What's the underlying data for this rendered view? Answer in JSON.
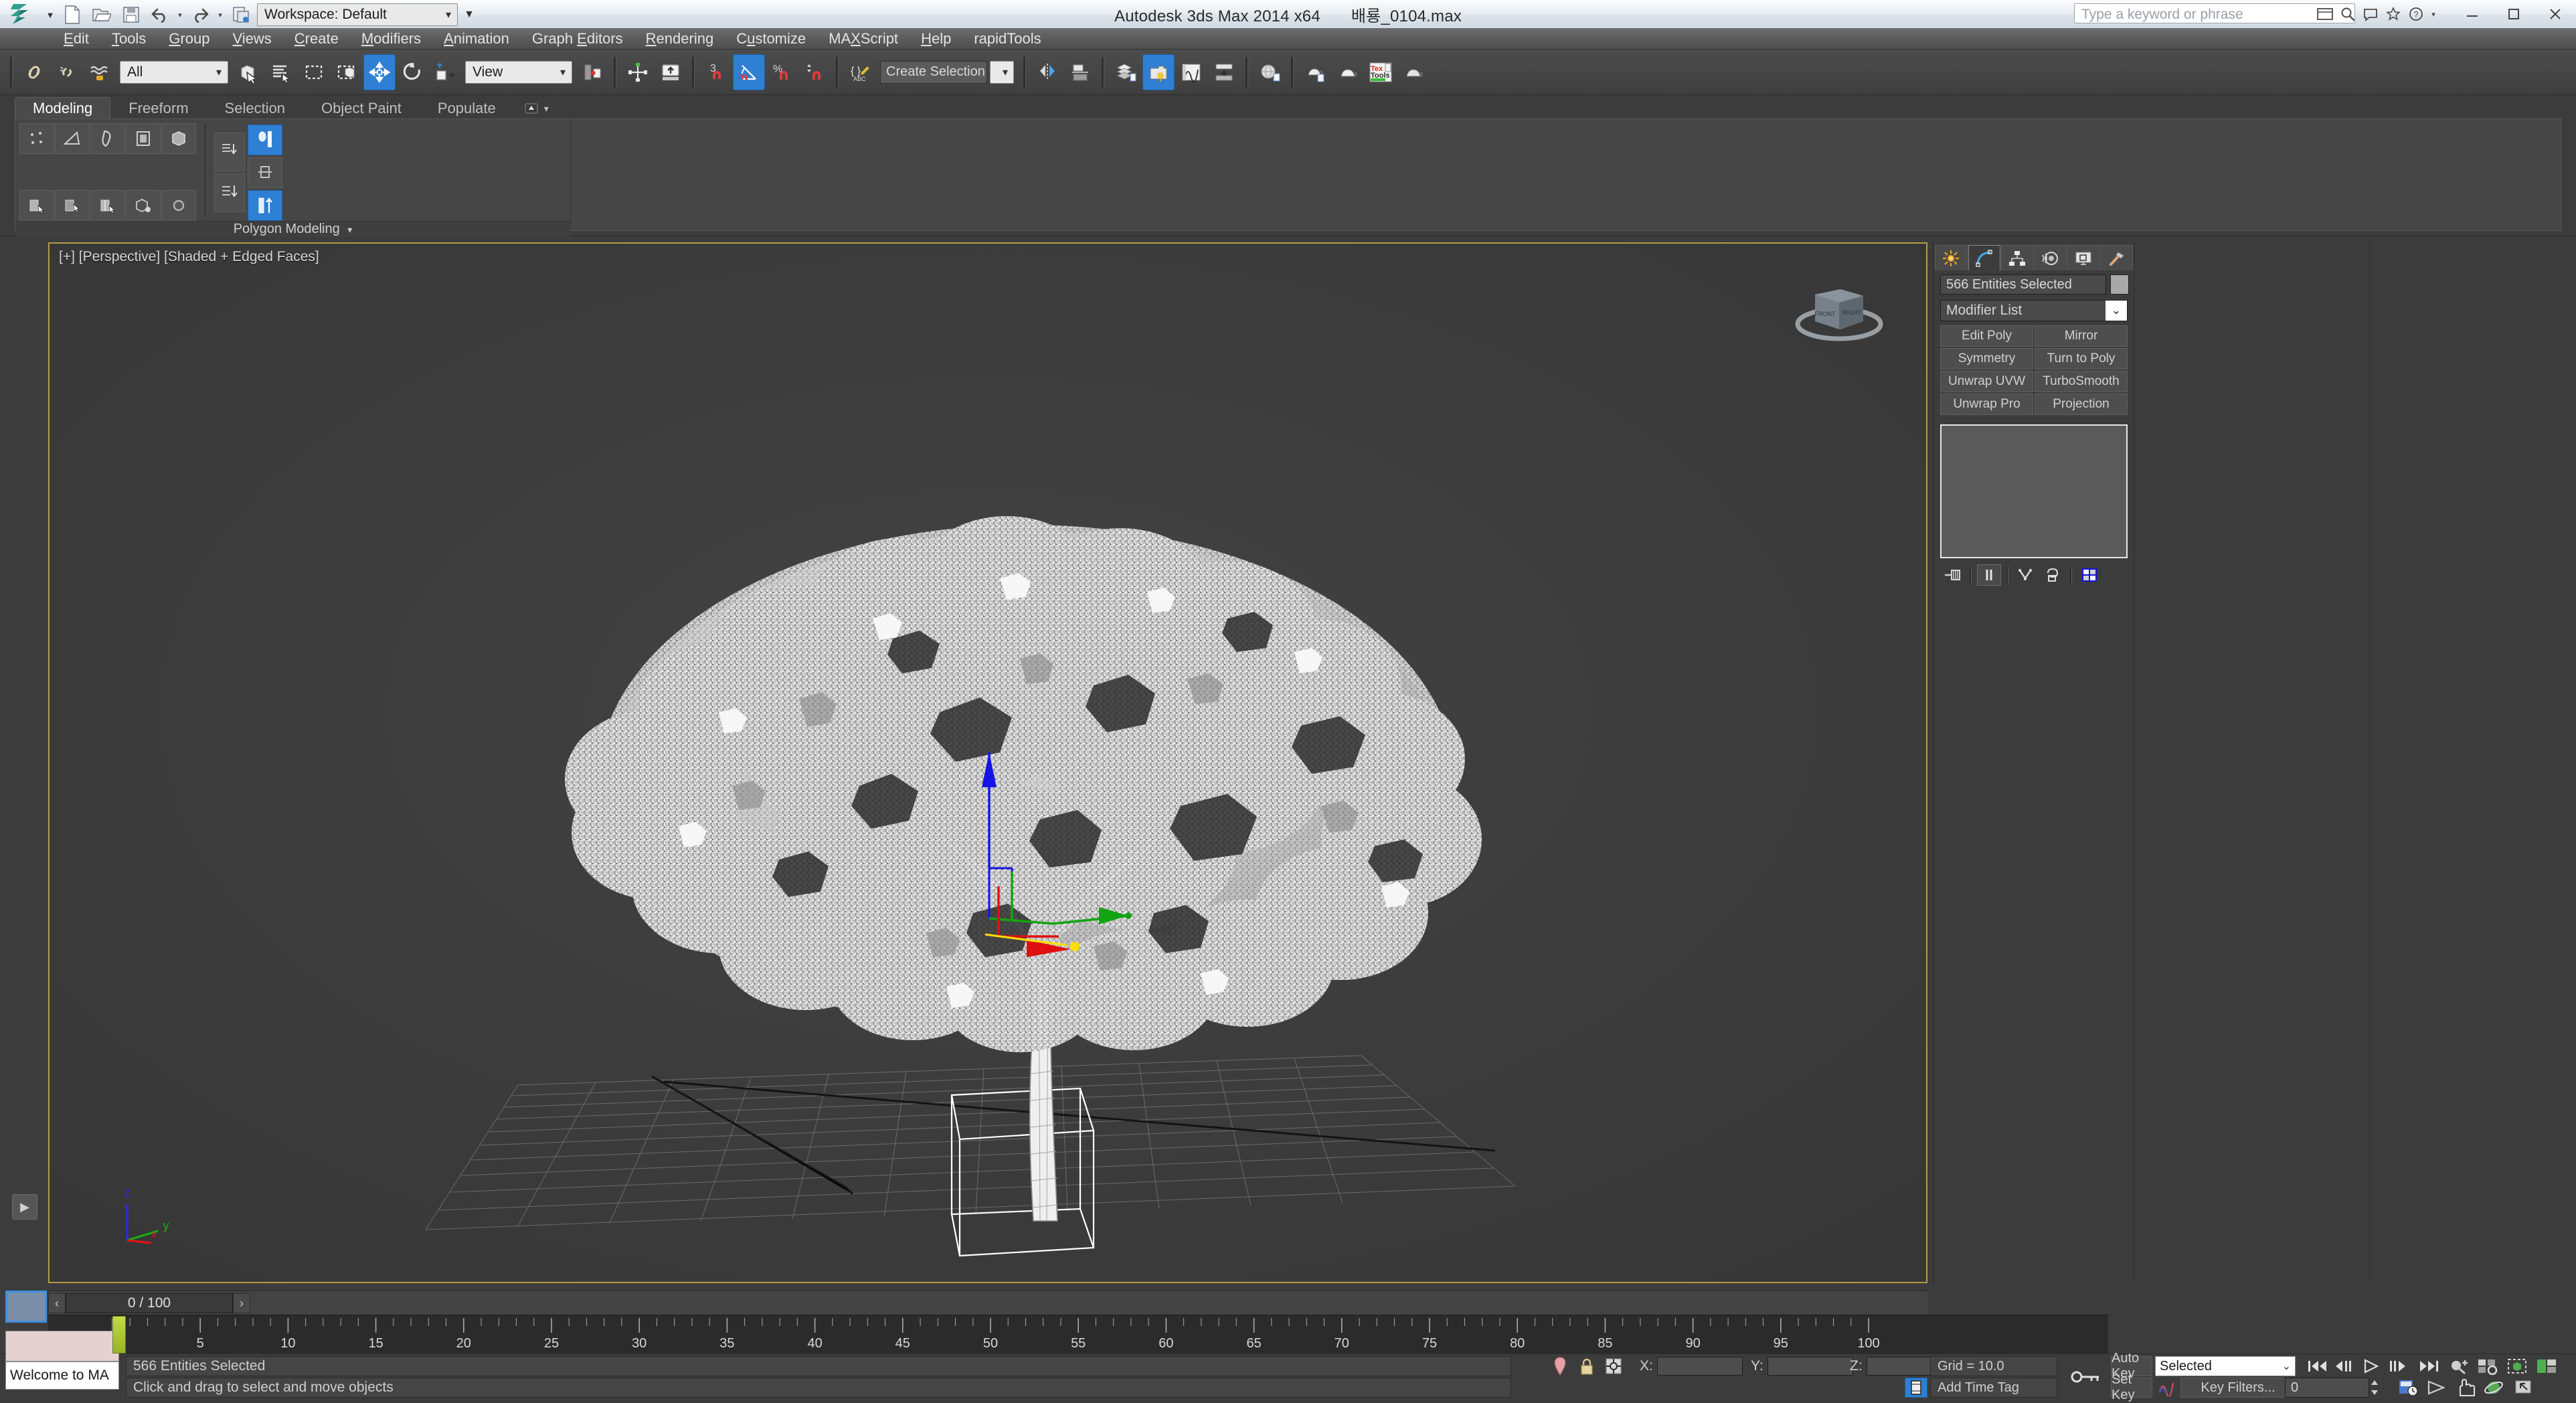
{
  "window": {
    "app_title": "Autodesk 3ds Max  2014 x64",
    "file_name": "배룡_0104.max",
    "search_placeholder": "Type a keyword or phrase",
    "minimize": "—",
    "maximize": "▢",
    "close": "✕"
  },
  "quick_access": {
    "workspace_label": "Workspace: Default",
    "items": [
      "new-file-icon",
      "open-file-icon",
      "save-file-icon",
      "undo-icon",
      "redo-icon",
      "workspace-icon"
    ]
  },
  "menu": {
    "items": [
      {
        "label": "Edit",
        "accel": "E"
      },
      {
        "label": "Tools",
        "accel": "T"
      },
      {
        "label": "Group",
        "accel": "G"
      },
      {
        "label": "Views",
        "accel": "V"
      },
      {
        "label": "Create",
        "accel": "C"
      },
      {
        "label": "Modifiers",
        "accel": "M"
      },
      {
        "label": "Animation",
        "accel": "A"
      },
      {
        "label": "Graph Editors",
        "accel": "E"
      },
      {
        "label": "Rendering",
        "accel": "R"
      },
      {
        "label": "Customize",
        "accel": "u"
      },
      {
        "label": "MAXScript",
        "accel": "X"
      },
      {
        "label": "Help",
        "accel": "H"
      },
      {
        "label": "rapidTools",
        "accel": ""
      }
    ]
  },
  "toolbar": {
    "select_filter": "All",
    "coord_system": "View",
    "selection_set": "Create Selection Set",
    "buttons": [
      "select-and-link-icon",
      "unlink-selection-icon",
      "bind-to-space-warp-icon",
      "select-object-icon",
      "select-by-name-icon",
      "rectangular-selection-region-icon",
      "window-crossing-icon",
      "select-and-move-icon",
      "select-and-rotate-icon",
      "select-and-scale-icon",
      "use-pivot-point-center-icon",
      "select-and-manipulate-icon",
      "snaps-toggle-icon",
      "angle-snap-toggle-icon",
      "percent-snap-toggle-icon",
      "spinner-snap-toggle-icon",
      "named-selection-sets-icon",
      "mirror-icon",
      "align-icon",
      "layer-manager-icon",
      "compact-material-editor-icon",
      "curve-editor-icon",
      "schematic-view-icon",
      "render-setup-icon",
      "rendered-frame-window-icon",
      "render-production-icon",
      "tex-tools-icon",
      "render-iterative-icon"
    ],
    "active_tool": "select-and-move-icon",
    "tex_tools_label_1": "Tex",
    "tex_tools_label_2": "Tools"
  },
  "ribbon": {
    "tabs": [
      {
        "label": "Modeling",
        "active": true
      },
      {
        "label": "Freeform",
        "active": false
      },
      {
        "label": "Selection",
        "active": false
      },
      {
        "label": "Object Paint",
        "active": false
      },
      {
        "label": "Populate",
        "active": false
      }
    ],
    "panel_label": "Polygon Modeling",
    "subobject_buttons": [
      "vertex-subobject-icon",
      "edge-subobject-icon",
      "border-subobject-icon",
      "polygon-subobject-icon",
      "element-subobject-icon"
    ],
    "tool_buttons": [
      "generate-topology-icon",
      "repeat-last-icon",
      "swift-loop-icon",
      "paint-connect-icon",
      "nurms-toggle-icon"
    ],
    "stack_buttons": [
      "collapse-stack-icon",
      "make-editable-poly-icon"
    ],
    "right_buttons": [
      "full-interactivity-icon",
      "constraint-icon",
      "preserve-uvs-icon"
    ]
  },
  "viewport": {
    "label": "[+] [Perspective] [Shaded + Edged Faces]",
    "view_type": "Perspective",
    "shading": "Shaded + Edged Faces",
    "axis_x": "x",
    "axis_y": "y",
    "axis_z": "z",
    "viewcube_front": "FRONT",
    "viewcube_right": "RIGHT",
    "border_color": "#b39b47",
    "background_color": "#3d3d3d",
    "gizmo_colors": {
      "x": "#e02020",
      "y": "#18b018",
      "z": "#2020e0",
      "highlight": "#ffe000"
    }
  },
  "command_panel": {
    "tabs": [
      {
        "name": "create-tab",
        "active": false
      },
      {
        "name": "modify-tab",
        "active": true
      },
      {
        "name": "hierarchy-tab",
        "active": false
      },
      {
        "name": "motion-tab",
        "active": false
      },
      {
        "name": "display-tab",
        "active": false
      },
      {
        "name": "utilities-tab",
        "active": false
      }
    ],
    "object_name": "566 Entities Selected",
    "modifier_list_label": "Modifier List",
    "modifier_buttons": [
      "Edit Poly",
      "Mirror",
      "Symmetry",
      "Turn to Poly",
      "Unwrap UVW",
      "TurboSmooth",
      "Unwrap Pro",
      "Projection"
    ],
    "stack_icons": [
      "pin-stack-icon",
      "show-end-result-icon",
      "make-unique-icon",
      "remove-modifier-icon",
      "configure-modifier-sets-icon"
    ]
  },
  "timeline": {
    "frame_display": "0 / 100",
    "prev_arrow": "‹",
    "next_arrow": "›",
    "start": 0,
    "end": 100,
    "current_frame": 0,
    "major_ticks": [
      0,
      5,
      10,
      15,
      20,
      25,
      30,
      35,
      40,
      45,
      50,
      55,
      60,
      65,
      70,
      75,
      80,
      85,
      90,
      95,
      100
    ],
    "tick_labels": [
      "5",
      "10",
      "15",
      "20",
      "25",
      "30",
      "35",
      "40",
      "45",
      "50",
      "55",
      "60",
      "65",
      "70",
      "75",
      "80",
      "85",
      "90",
      "95",
      "100"
    ]
  },
  "status_bar": {
    "selection_text": "566 Entities Selected",
    "prompt_text": "Click and drag to select and move objects",
    "listener_text": "Welcome to MA",
    "coord_x_label": "X:",
    "coord_y_label": "Y:",
    "coord_z_label": "Z:",
    "coord_x_value": "",
    "coord_y_value": "",
    "coord_z_value": "",
    "grid_text": "Grid = 10.0",
    "time_tag_text": "Add Time Tag",
    "icons": [
      "isolate-selection-icon",
      "selection-lock-icon",
      "absolute-relative-mode-icon"
    ]
  },
  "animation": {
    "auto_key_label": "Auto Key",
    "set_key_label": "Set Key",
    "key_mode_value": "Selected",
    "key_filters_label": "Key Filters...",
    "current_frame": "0",
    "playback_icons": [
      "goto-start-icon",
      "previous-frame-icon",
      "play-animation-icon",
      "next-frame-icon",
      "goto-end-icon",
      "key-mode-toggle-icon"
    ],
    "nav_icons": [
      "zoom-icon",
      "zoom-all-icon",
      "zoom-extents-icon",
      "zoom-region-icon",
      "field-of-view-icon",
      "pan-view-icon",
      "orbit-icon",
      "maximize-viewport-icon"
    ]
  }
}
